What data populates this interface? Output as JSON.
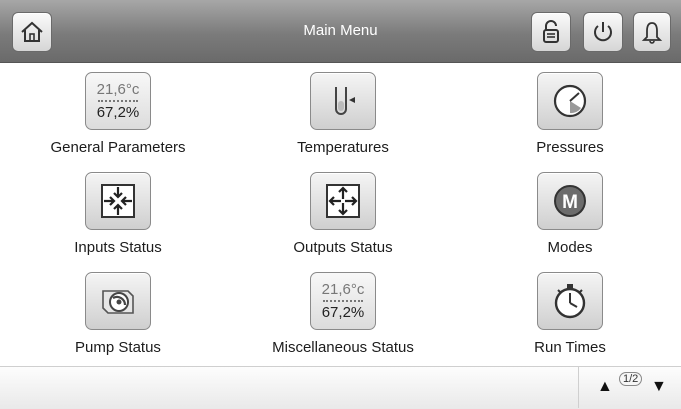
{
  "header": {
    "title": "Main Menu",
    "buttons": {
      "home": "home-icon",
      "unlock": "unlock-icon",
      "power": "power-icon",
      "alarm": "bell-icon"
    }
  },
  "menu": {
    "general_parameters": {
      "label": "General Parameters",
      "line1": "21,6°c",
      "line2": "67,2%"
    },
    "temperatures": {
      "label": "Temperatures",
      "icon": "thermometer-icon"
    },
    "pressures": {
      "label": "Pressures",
      "icon": "gauge-icon"
    },
    "inputs_status": {
      "label": "Inputs Status",
      "icon": "inputs-arrows-icon"
    },
    "outputs_status": {
      "label": "Outputs Status",
      "icon": "outputs-arrows-icon"
    },
    "modes": {
      "label": "Modes",
      "icon": "modes-m-icon"
    },
    "pump_status": {
      "label": "Pump Status",
      "icon": "pump-icon"
    },
    "miscellaneous_status": {
      "label": "Miscellaneous Status",
      "line1": "21,6°c",
      "line2": "67,2%"
    },
    "run_times": {
      "label": "Run Times",
      "icon": "stopwatch-icon"
    }
  },
  "pager": {
    "page": "1/2",
    "up_icon": "arrow-up-icon",
    "down_icon": "arrow-down-icon"
  },
  "colors": {
    "header": "#7b7b7b",
    "icon_bg": "#dcdcdc",
    "text": "#1c1c1c"
  }
}
